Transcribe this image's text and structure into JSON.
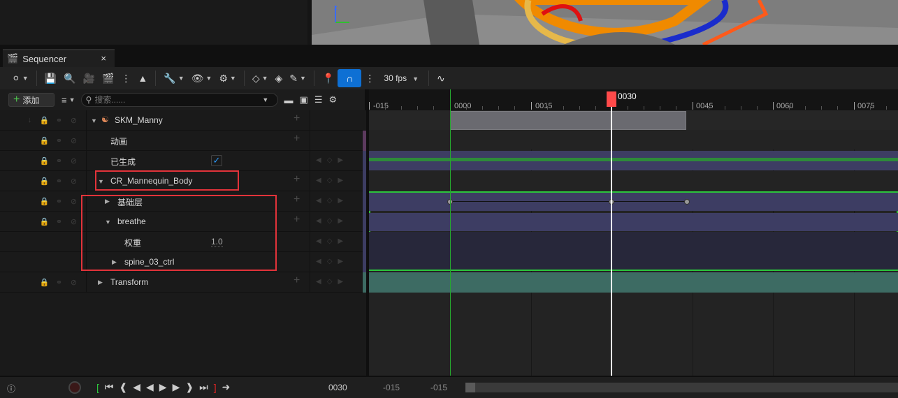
{
  "tab": {
    "title": "Sequencer",
    "close": "×"
  },
  "toolbar": {
    "fps": "30 fps"
  },
  "outliner": {
    "add_label": "添加",
    "search_placeholder": "搜索......",
    "rows": [
      {
        "label": "SKM_Manny"
      },
      {
        "label": "动画"
      },
      {
        "label": "已生成"
      },
      {
        "label": "CR_Mannequin_Body"
      },
      {
        "label": "基础层"
      },
      {
        "label": "breathe"
      },
      {
        "label": "权重",
        "value": "1.0"
      },
      {
        "label": "spine_03_ctrl"
      },
      {
        "label": "Transform"
      }
    ]
  },
  "timeline": {
    "ticks": [
      "-015",
      "0000",
      "0015",
      "0030",
      "0045",
      "0060",
      "0075"
    ],
    "playhead": "0030"
  },
  "transport": {
    "current_frame": "0030",
    "view_start": "-015",
    "view_end": "-015"
  },
  "colors": {
    "accent": "#0e70d4",
    "playhead": "#ff4a4a",
    "highlight": "#e2333a",
    "track_purple": "#3d3d63",
    "track_teal": "#3d6b63",
    "start_marker": "#26a62f"
  }
}
